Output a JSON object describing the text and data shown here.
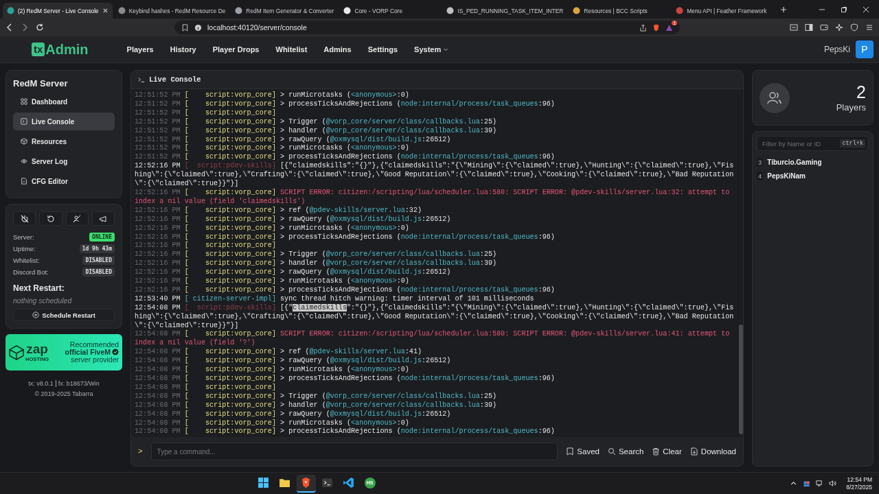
{
  "browser": {
    "tabs": [
      {
        "title": "(2) RedM Server - Live Console",
        "selected": true
      },
      {
        "title": "Keybind hashes - RedM Resource De",
        "selected": false
      },
      {
        "title": "RedM Item Generator & Converter",
        "selected": false
      },
      {
        "title": "Core - VORP Core",
        "selected": false
      },
      {
        "title": "IS_PED_RUNNING_TASK_ITEM_INTER",
        "selected": false
      },
      {
        "title": "Resources | BCC Scripts",
        "selected": false
      },
      {
        "title": "Menu API | Feather Framework",
        "selected": false
      }
    ],
    "address": "localhost:40120/server/console",
    "shield_count": "1"
  },
  "nav": {
    "brand_mark": "tx",
    "brand": "Admin",
    "items": [
      {
        "label": "Players",
        "kind": "link"
      },
      {
        "label": "History",
        "kind": "link"
      },
      {
        "label": "Player Drops",
        "kind": "link"
      },
      {
        "label": "Whitelist",
        "kind": "link"
      },
      {
        "label": "Admins",
        "kind": "link"
      },
      {
        "label": "Settings",
        "kind": "link"
      },
      {
        "label": "System",
        "kind": "dropdown"
      }
    ],
    "user": "PepsKi",
    "avatar": "P"
  },
  "sidebar": {
    "title": "RedM Server",
    "items": [
      {
        "label": "Dashboard",
        "selected": false
      },
      {
        "label": "Live Console",
        "selected": true
      },
      {
        "label": "Resources",
        "selected": false
      },
      {
        "label": "Server Log",
        "selected": false
      },
      {
        "label": "CFG Editor",
        "selected": false
      }
    ]
  },
  "status": {
    "rows": [
      {
        "label": "Server:",
        "value": "ONLINE",
        "kind": "good"
      },
      {
        "label": "Uptime:",
        "value": "1d 9h 43m",
        "kind": "neutral"
      },
      {
        "label": "Whitelist:",
        "value": "DISABLED",
        "kind": "neutral"
      },
      {
        "label": "Discord Bot:",
        "value": "DISABLED",
        "kind": "neutral"
      }
    ],
    "next_restart_title": "Next Restart:",
    "next_restart": "nothing scheduled",
    "schedule_button": "Schedule Restart"
  },
  "ad": {
    "logo": "zap",
    "logo_sub": "HOSTING",
    "lines": [
      "Recommended",
      "official FiveM",
      "server provider"
    ]
  },
  "footer": {
    "tx": "tx: v8.0.1",
    "fx": "fx: b18673/Win",
    "copyright": "© 2019-2025 Tabarra"
  },
  "console": {
    "title": "Live Console",
    "lines": [
      {
        "time": "12:51:52 PM",
        "kind": "trace",
        "source": "[    script:vorp_core]",
        "parts": [
          {
            "kind": "plain",
            "text": "> runMicrotasks ("
          },
          {
            "kind": "link",
            "text": "<anonymous>"
          },
          {
            "kind": "plain",
            "text": ":0)"
          }
        ]
      },
      {
        "time": "12:51:52 PM",
        "kind": "trace",
        "source": "[    script:vorp_core]",
        "parts": [
          {
            "kind": "plain",
            "text": "> processTicksAndRejections ("
          },
          {
            "kind": "link",
            "text": "node:internal/process/task_queues"
          },
          {
            "kind": "plain",
            "text": ":96)"
          }
        ]
      },
      {
        "time": "12:51:52 PM",
        "kind": "trace",
        "source": "[    script:vorp_core]"
      },
      {
        "time": "12:51:52 PM",
        "kind": "trace",
        "source": "[    script:vorp_core]",
        "parts": [
          {
            "kind": "plain",
            "text": "> Trigger ("
          },
          {
            "kind": "link",
            "text": "@vorp_core/server/class/callbacks.lua"
          },
          {
            "kind": "plain",
            "text": ":25)"
          }
        ]
      },
      {
        "time": "12:51:52 PM",
        "kind": "trace",
        "source": "[    script:vorp_core]",
        "parts": [
          {
            "kind": "plain",
            "text": "> handler ("
          },
          {
            "kind": "link",
            "text": "@vorp_core/server/class/callbacks.lua"
          },
          {
            "kind": "plain",
            "text": ":39)"
          }
        ]
      },
      {
        "time": "12:51:52 PM",
        "kind": "trace",
        "source": "[    script:vorp_core]",
        "parts": [
          {
            "kind": "plain",
            "text": "> rawQuery ("
          },
          {
            "kind": "link",
            "text": "@oxmysql/dist/build.js"
          },
          {
            "kind": "plain",
            "text": ":26512)"
          }
        ]
      },
      {
        "time": "12:51:52 PM",
        "kind": "trace",
        "source": "[    script:vorp_core]",
        "parts": [
          {
            "kind": "plain",
            "text": "> runMicrotasks ("
          },
          {
            "kind": "link",
            "text": "<anonymous>"
          },
          {
            "kind": "plain",
            "text": ":0)"
          }
        ]
      },
      {
        "time": "12:51:52 PM",
        "kind": "trace",
        "source": "[    script:vorp_core]",
        "parts": [
          {
            "kind": "plain",
            "text": "> processTicksAndRejections ("
          },
          {
            "kind": "link",
            "text": "node:internal/process/task_queues"
          },
          {
            "kind": "plain",
            "text": ":96)"
          }
        ]
      },
      {
        "time": "12:52:16 PM",
        "kind": "data",
        "source": "[  script:pdev-skills]",
        "parts": [
          {
            "kind": "plain",
            "text": "[{\"claimedskills\":\"{}\"},{\"claimedskills\":\"{\\\"Mining\\\":{\\\"claimed\\\":true},\\\"Hunting\\\":{\\\"claimed\\\":true},\\\"Fishing\\\":{\\\"claimed\\\":true},\\\"Crafting\\\":{\\\"claimed\\\":true},\\\"Good Reputation\\\":{\\\"claimed\\\":true},\\\"Cooking\\\":{\\\"claimed\\\":true},\\\"Bad Reputation\\\":{\\\"claimed\\\":true}}\"}]"
          }
        ]
      },
      {
        "time": "12:52:16 PM",
        "kind": "trace",
        "source": "[    script:vorp_core]",
        "parts": [
          {
            "kind": "error",
            "text": "SCRIPT ERROR: citizen:/scripting/lua/scheduler.lua:580: SCRIPT ERROR: @pdev-skills/server.lua:32: attempt to index a nil value (field 'claimedskills')"
          }
        ]
      },
      {
        "time": "12:52:16 PM",
        "kind": "trace",
        "source": "[    script:vorp_core]",
        "parts": [
          {
            "kind": "plain",
            "text": "> ref ("
          },
          {
            "kind": "link",
            "text": "@pdev-skills/server.lua"
          },
          {
            "kind": "plain",
            "text": ":32)"
          }
        ]
      },
      {
        "time": "12:52:16 PM",
        "kind": "trace",
        "source": "[    script:vorp_core]",
        "parts": [
          {
            "kind": "plain",
            "text": "> rawQuery ("
          },
          {
            "kind": "link",
            "text": "@oxmysql/dist/build.js"
          },
          {
            "kind": "plain",
            "text": ":26512)"
          }
        ]
      },
      {
        "time": "12:52:16 PM",
        "kind": "trace",
        "source": "[    script:vorp_core]",
        "parts": [
          {
            "kind": "plain",
            "text": "> runMicrotasks ("
          },
          {
            "kind": "link",
            "text": "<anonymous>"
          },
          {
            "kind": "plain",
            "text": ":0)"
          }
        ]
      },
      {
        "time": "12:52:16 PM",
        "kind": "trace",
        "source": "[    script:vorp_core]",
        "parts": [
          {
            "kind": "plain",
            "text": "> processTicksAndRejections ("
          },
          {
            "kind": "link",
            "text": "node:internal/process/task_queues"
          },
          {
            "kind": "plain",
            "text": ":96)"
          }
        ]
      },
      {
        "time": "12:52:16 PM",
        "kind": "trace",
        "source": "[    script:vorp_core]"
      },
      {
        "time": "12:52:16 PM",
        "kind": "trace",
        "source": "[    script:vorp_core]",
        "parts": [
          {
            "kind": "plain",
            "text": "> Trigger ("
          },
          {
            "kind": "link",
            "text": "@vorp_core/server/class/callbacks.lua"
          },
          {
            "kind": "plain",
            "text": ":25)"
          }
        ]
      },
      {
        "time": "12:52:16 PM",
        "kind": "trace",
        "source": "[    script:vorp_core]",
        "parts": [
          {
            "kind": "plain",
            "text": "> handler ("
          },
          {
            "kind": "link",
            "text": "@vorp_core/server/class/callbacks.lua"
          },
          {
            "kind": "plain",
            "text": ":39)"
          }
        ]
      },
      {
        "time": "12:52:16 PM",
        "kind": "trace",
        "source": "[    script:vorp_core]",
        "parts": [
          {
            "kind": "plain",
            "text": "> rawQuery ("
          },
          {
            "kind": "link",
            "text": "@oxmysql/dist/build.js"
          },
          {
            "kind": "plain",
            "text": ":26512)"
          }
        ]
      },
      {
        "time": "12:52:16 PM",
        "kind": "trace",
        "source": "[    script:vorp_core]",
        "parts": [
          {
            "kind": "plain",
            "text": "> runMicrotasks ("
          },
          {
            "kind": "link",
            "text": "<anonymous>"
          },
          {
            "kind": "plain",
            "text": ":0)"
          }
        ]
      },
      {
        "time": "12:52:16 PM",
        "kind": "trace",
        "source": "[    script:vorp_core]",
        "parts": [
          {
            "kind": "plain",
            "text": "> processTicksAndRejections ("
          },
          {
            "kind": "link",
            "text": "node:internal/process/task_queues"
          },
          {
            "kind": "plain",
            "text": ":96)"
          }
        ]
      },
      {
        "time": "12:53:40 PM",
        "kind": "system",
        "source": "[ citizen-server-impl]",
        "parts": [
          {
            "kind": "plain",
            "text": "sync thread hitch warning: timer interval of 101 milliseconds"
          }
        ]
      },
      {
        "time": "12:54:08 PM",
        "kind": "data",
        "source": "[  script:pdev-skills]",
        "parts": [
          {
            "kind": "plain",
            "text": "[{\""
          },
          {
            "kind": "selected",
            "text": "claimedskills"
          },
          {
            "kind": "plain",
            "text": "\":\"{}\"},{\"claimedskills\":\"{\\\"Mining\\\":{\\\"claimed\\\":true},\\\"Hunting\\\":{\\\"claimed\\\":true},\\\"Fishing\\\":{\\\"claimed\\\":true},\\\"Crafting\\\":{\\\"claimed\\\":true},\\\"Good Reputation\\\":{\\\"claimed\\\":true},\\\"Cooking\\\":{\\\"claimed\\\":true},\\\"Bad Reputation\\\":{\\\"claimed\\\":true}}\"}]"
          }
        ]
      },
      {
        "time": "12:54:08 PM",
        "kind": "trace",
        "source": "[    script:vorp_core]",
        "parts": [
          {
            "kind": "error",
            "text": "SCRIPT ERROR: citizen:/scripting/lua/scheduler.lua:580: SCRIPT ERROR: @pdev-skills/server.lua:41: attempt to index a nil value (field '?')"
          }
        ]
      },
      {
        "time": "12:54:08 PM",
        "kind": "trace",
        "source": "[    script:vorp_core]",
        "parts": [
          {
            "kind": "plain",
            "text": "> ref ("
          },
          {
            "kind": "link",
            "text": "@pdev-skills/server.lua"
          },
          {
            "kind": "plain",
            "text": ":41)"
          }
        ]
      },
      {
        "time": "12:54:08 PM",
        "kind": "trace",
        "source": "[    script:vorp_core]",
        "parts": [
          {
            "kind": "plain",
            "text": "> rawQuery ("
          },
          {
            "kind": "link",
            "text": "@oxmysql/dist/build.js"
          },
          {
            "kind": "plain",
            "text": ":26512)"
          }
        ]
      },
      {
        "time": "12:54:08 PM",
        "kind": "trace",
        "source": "[    script:vorp_core]",
        "parts": [
          {
            "kind": "plain",
            "text": "> runMicrotasks ("
          },
          {
            "kind": "link",
            "text": "<anonymous>"
          },
          {
            "kind": "plain",
            "text": ":0)"
          }
        ]
      },
      {
        "time": "12:54:08 PM",
        "kind": "trace",
        "source": "[    script:vorp_core]",
        "parts": [
          {
            "kind": "plain",
            "text": "> processTicksAndRejections ("
          },
          {
            "kind": "link",
            "text": "node:internal/process/task_queues"
          },
          {
            "kind": "plain",
            "text": ":96)"
          }
        ]
      },
      {
        "time": "12:54:08 PM",
        "kind": "trace",
        "source": "[    script:vorp_core]"
      },
      {
        "time": "12:54:08 PM",
        "kind": "trace",
        "source": "[    script:vorp_core]",
        "parts": [
          {
            "kind": "plain",
            "text": "> Trigger ("
          },
          {
            "kind": "link",
            "text": "@vorp_core/server/class/callbacks.lua"
          },
          {
            "kind": "plain",
            "text": ":25)"
          }
        ]
      },
      {
        "time": "12:54:08 PM",
        "kind": "trace",
        "source": "[    script:vorp_core]",
        "parts": [
          {
            "kind": "plain",
            "text": "> handler ("
          },
          {
            "kind": "link",
            "text": "@vorp_core/server/class/callbacks.lua"
          },
          {
            "kind": "plain",
            "text": ":39)"
          }
        ]
      },
      {
        "time": "12:54:08 PM",
        "kind": "trace",
        "source": "[    script:vorp_core]",
        "parts": [
          {
            "kind": "plain",
            "text": "> rawQuery ("
          },
          {
            "kind": "link",
            "text": "@oxmysql/dist/build.js"
          },
          {
            "kind": "plain",
            "text": ":26512)"
          }
        ]
      },
      {
        "time": "12:54:08 PM",
        "kind": "trace",
        "source": "[    script:vorp_core]",
        "parts": [
          {
            "kind": "plain",
            "text": "> runMicrotasks ("
          },
          {
            "kind": "link",
            "text": "<anonymous>"
          },
          {
            "kind": "plain",
            "text": ":0)"
          }
        ]
      },
      {
        "time": "12:54:08 PM",
        "kind": "trace",
        "source": "[    script:vorp_core]",
        "parts": [
          {
            "kind": "plain",
            "text": "> processTicksAndRejections ("
          },
          {
            "kind": "link",
            "text": "node:internal/process/task_queues"
          },
          {
            "kind": "plain",
            "text": ":96)"
          }
        ]
      }
    ],
    "prompt": ">",
    "placeholder": "Type a command...",
    "actions": [
      "Saved",
      "Search",
      "Clear",
      "Download"
    ]
  },
  "players": {
    "count": "2",
    "label": "Players",
    "filter_placeholder": "Filter by Name or ID",
    "shortcut": "ctrl+k",
    "list": [
      {
        "id": "3",
        "name": "Tiburcio.Gaming"
      },
      {
        "id": "4",
        "name": "PepsKiNam"
      }
    ]
  },
  "taskbar": {
    "apps": [
      {
        "kind": "start",
        "selected": false
      },
      {
        "kind": "folder",
        "selected": false
      },
      {
        "kind": "browser",
        "selected": true
      },
      {
        "kind": "terminal",
        "selected": false
      },
      {
        "kind": "editor",
        "selected": false
      },
      {
        "kind": "badge",
        "label": "HS",
        "selected": false
      }
    ],
    "time": "12:54 PM",
    "date": "8/27/2025"
  }
}
